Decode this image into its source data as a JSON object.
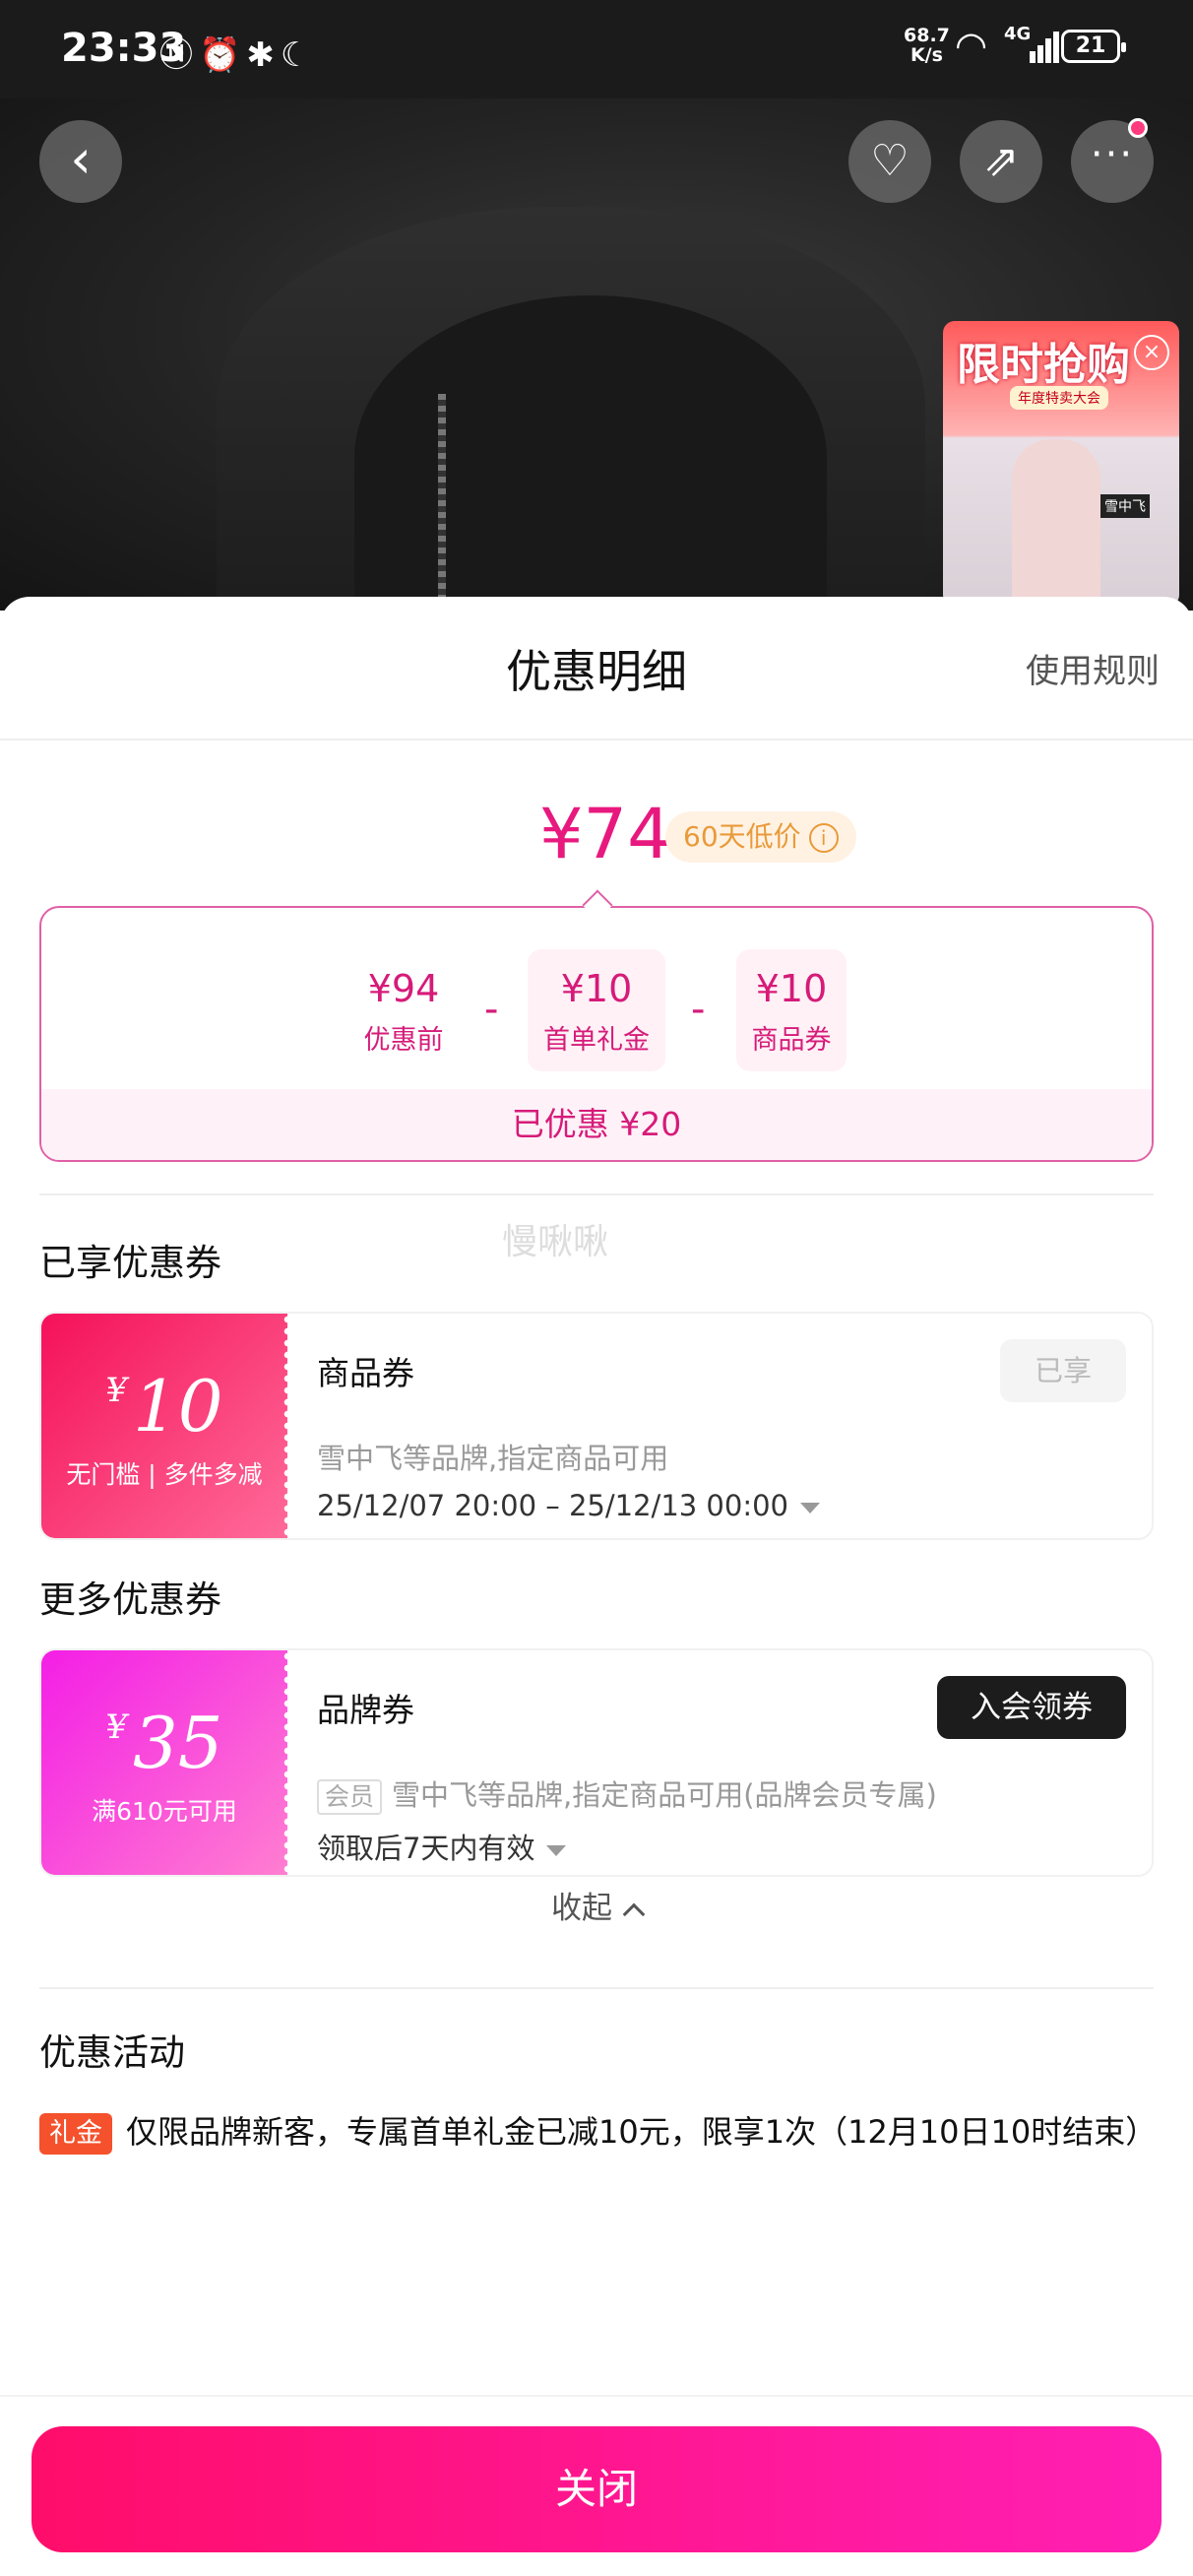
{
  "status_bar": {
    "time": "23:33",
    "net_speed_value": "68.7",
    "net_speed_unit": "K/s",
    "signal_type": "4G",
    "battery": "21"
  },
  "product_header": {
    "promo_title": "限时抢购",
    "promo_subtitle": "年度特卖大会",
    "promo_brand": "雪中飞"
  },
  "sheet": {
    "title": "优惠明细",
    "rules_link": "使用规则"
  },
  "price": {
    "final": "¥74",
    "low_tag": "60天低价"
  },
  "calc": {
    "items": [
      {
        "value": "¥94",
        "label": "优惠前"
      },
      {
        "value": "¥10",
        "label": "首单礼金"
      },
      {
        "value": "¥10",
        "label": "商品券"
      }
    ],
    "minus": "-",
    "saved": "已优惠 ¥20"
  },
  "watermark": "慢啾啾",
  "enjoyed_section": {
    "title": "已享优惠券",
    "coupon": {
      "yen": "¥",
      "amount": "10",
      "condition": "无门槛 | 多件多减",
      "name": "商品券",
      "desc": "雪中飞等品牌,指定商品可用",
      "validity": "25/12/07 20:00 – 25/12/13 00:00",
      "status": "已享"
    }
  },
  "more_section": {
    "title": "更多优惠券",
    "coupon": {
      "yen": "¥",
      "amount": "35",
      "condition": "满610元可用",
      "name": "品牌券",
      "member_tag": "会员",
      "desc": "雪中飞等品牌,指定商品可用(品牌会员专属)",
      "validity": "领取后7天内有效",
      "action": "入会领券"
    },
    "collapse": "收起"
  },
  "activity": {
    "title": "优惠活动",
    "tag": "礼金",
    "text": "仅限品牌新客，专属首单礼金已减10元，限享1次（12月10日10时结束）"
  },
  "close_button": "关闭"
}
